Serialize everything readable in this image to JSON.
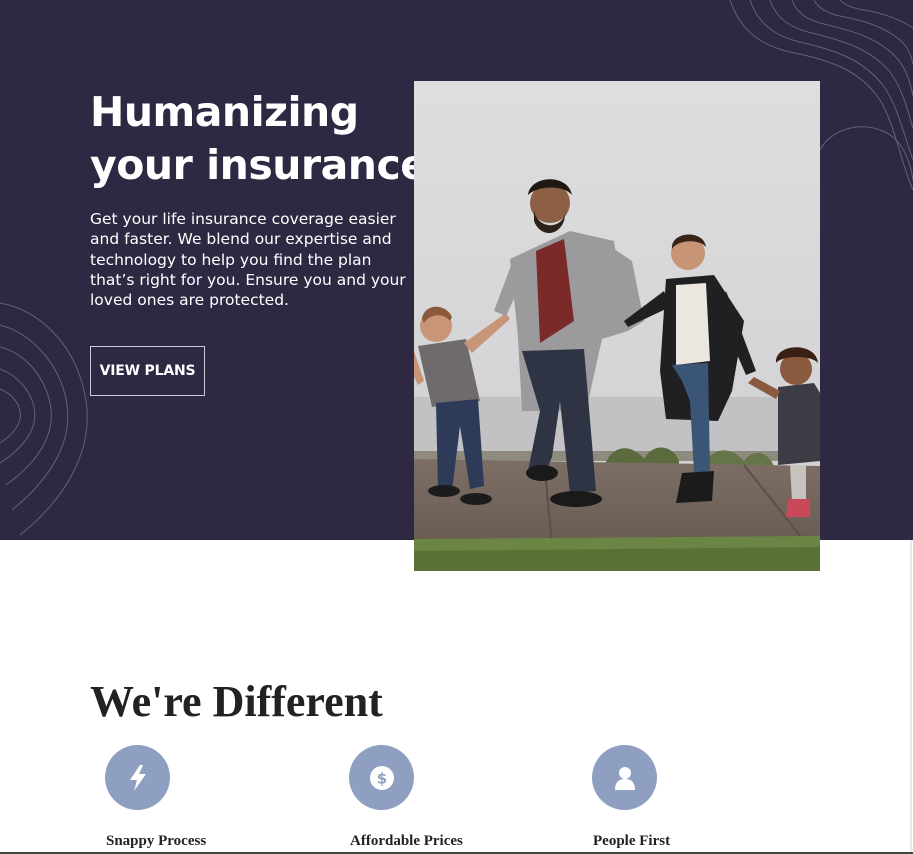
{
  "hero": {
    "title_line1": "Humanizing",
    "title_line2": "your insurance.",
    "description": "Get your life insurance coverage easier and faster. We blend our expertise and technology to help you find the plan that’s right for you. Ensure you and your loved ones are protected.",
    "cta_label": "VIEW PLANS",
    "background_color": "#2e2843"
  },
  "features": {
    "title": "We're Different",
    "icon_color": "#8e9fc2",
    "items": [
      {
        "label": "Snappy Process",
        "icon": "lightning-icon"
      },
      {
        "label": "Affordable Prices",
        "icon": "dollar-coin-icon"
      },
      {
        "label": "People First",
        "icon": "person-icon"
      }
    ]
  }
}
